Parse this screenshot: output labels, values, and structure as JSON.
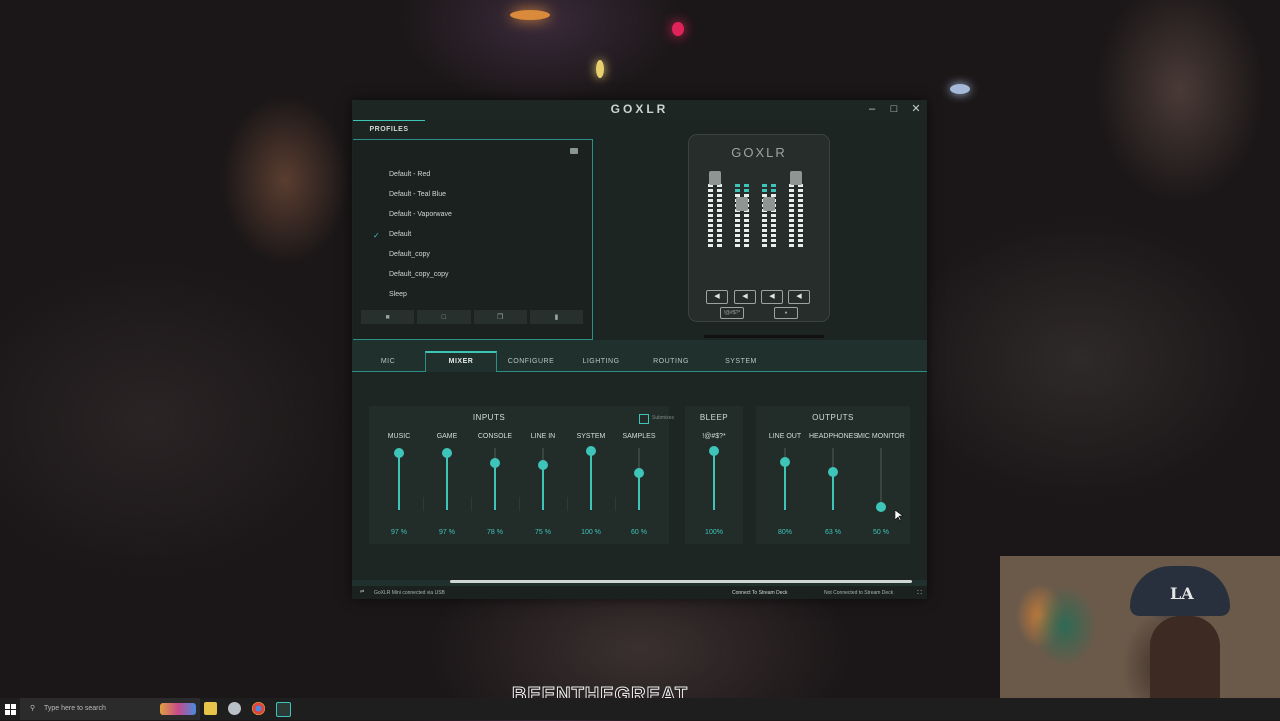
{
  "app": {
    "logo": "GOXLR",
    "window_controls": {
      "minimize": "–",
      "maximize": "□",
      "close": "✕"
    }
  },
  "profiles": {
    "tab_label": "PROFILES",
    "items": [
      {
        "label": "Default - Red",
        "checked": false
      },
      {
        "label": "Default - Teal Blue",
        "checked": false
      },
      {
        "label": "Default - Vaporwave",
        "checked": false
      },
      {
        "label": "Default",
        "checked": true
      },
      {
        "label": "Default_copy",
        "checked": false
      },
      {
        "label": "Default_copy_copy",
        "checked": false
      },
      {
        "label": "Sleep",
        "checked": false
      }
    ],
    "check_glyph": "✓",
    "actions": [
      {
        "name": "save-profile-icon",
        "glyph": "■"
      },
      {
        "name": "new-profile-icon",
        "glyph": "□"
      },
      {
        "name": "duplicate-profile-icon",
        "glyph": "❐"
      },
      {
        "name": "delete-profile-icon",
        "glyph": "▮"
      }
    ]
  },
  "device": {
    "logo": "GOXLR",
    "bleep_label": "!@#$?*"
  },
  "tabs": [
    {
      "label": "MIC",
      "active": false
    },
    {
      "label": "MIXER",
      "active": true
    },
    {
      "label": "CONFIGURE",
      "active": false
    },
    {
      "label": "LIGHTING",
      "active": false
    },
    {
      "label": "ROUTING",
      "active": false
    },
    {
      "label": "SYSTEM",
      "active": false
    }
  ],
  "mixer": {
    "inputs": {
      "title": "INPUTS",
      "submix_label": "Submixes",
      "channels": [
        {
          "label": "MUSIC",
          "value_text": "97 %",
          "level": 97
        },
        {
          "label": "GAME",
          "value_text": "97 %",
          "level": 97
        },
        {
          "label": "CONSOLE",
          "value_text": "78 %",
          "level": 78
        },
        {
          "label": "LINE IN",
          "value_text": "75 %",
          "level": 75
        },
        {
          "label": "SYSTEM",
          "value_text": "100 %",
          "level": 100
        },
        {
          "label": "SAMPLES",
          "value_text": "60 %",
          "level": 60
        }
      ]
    },
    "bleep": {
      "title": "BLEEP",
      "channel": {
        "label": "!@#$?*",
        "value_text": "100%",
        "level": 100
      }
    },
    "outputs": {
      "title": "OUTPUTS",
      "channels": [
        {
          "label": "LINE OUT",
          "value_text": "80%",
          "level": 80
        },
        {
          "label": "HEADPHONES",
          "value_text": "63 %",
          "level": 63
        },
        {
          "label": "MIC MONITOR",
          "value_text": "50 %",
          "level": 0
        }
      ]
    }
  },
  "status_bar": {
    "device_status": "GoXLR Mini connected via USB",
    "stream_deck_link": "Connect To Stream Deck",
    "stream_deck_status": "Not Connected to Stream Deck"
  },
  "taskbar": {
    "search_placeholder": "Type here to search"
  },
  "overlay": {
    "text": "BEENTHEGREAT"
  },
  "webcam": {
    "cap_logo": "LA"
  },
  "colors": {
    "accent": "#3ec4b8",
    "window_bg": "#20302c"
  }
}
